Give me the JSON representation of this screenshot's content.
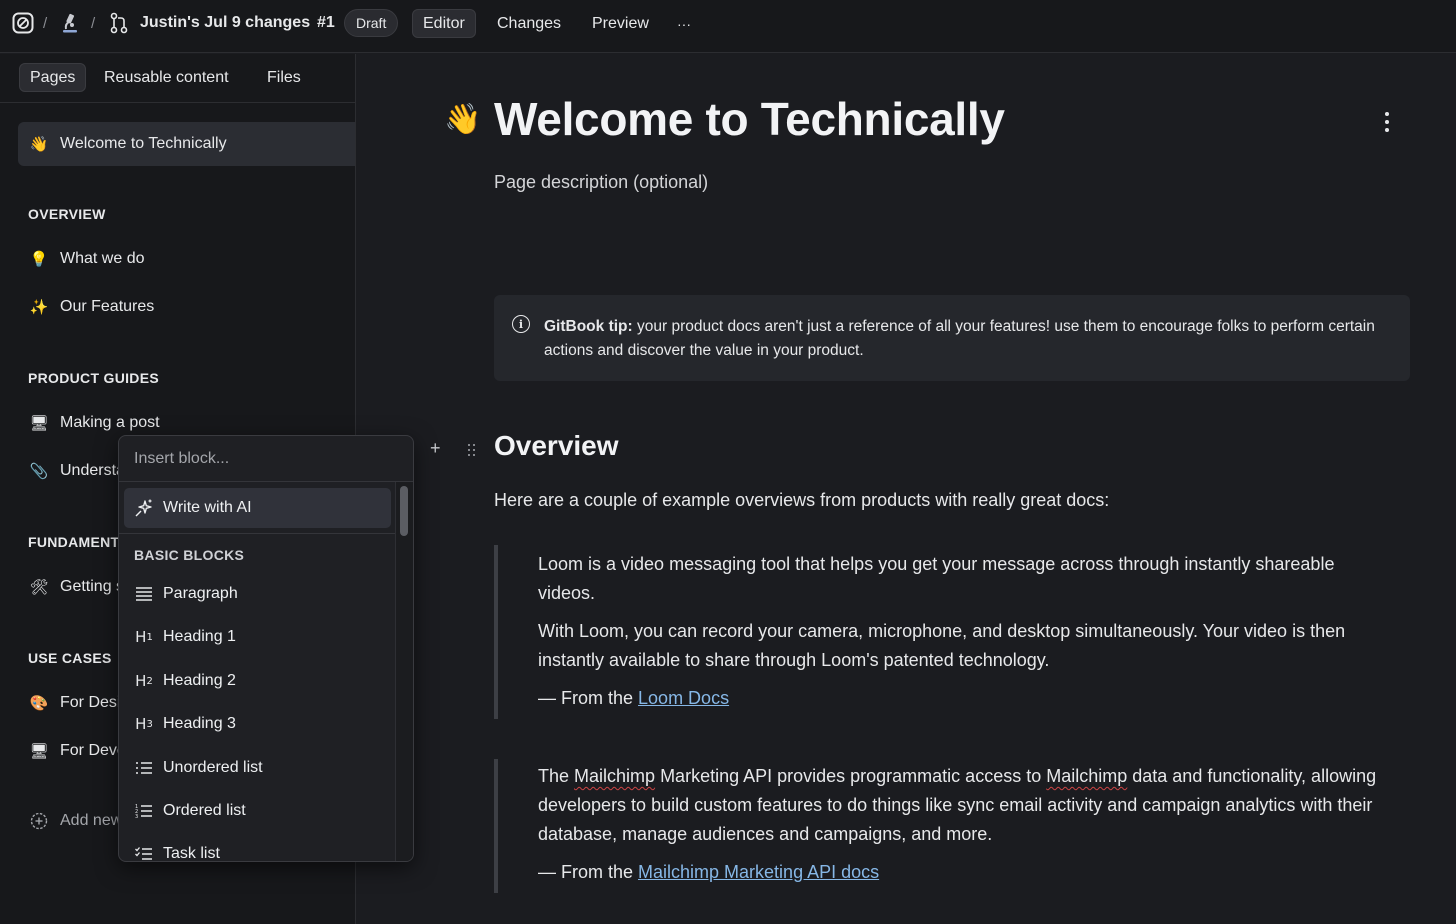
{
  "topbar": {
    "breadcrumb_sep": "/",
    "change_request_title": "Justin's Jul 9 changes",
    "change_request_number": "#1",
    "status_badge": "Draft",
    "tabs": [
      {
        "label": "Editor",
        "active": true
      },
      {
        "label": "Changes",
        "active": false
      },
      {
        "label": "Preview",
        "active": false
      }
    ],
    "more_label": "···",
    "icons": [
      "gitbook-logo-icon",
      "microscope-icon",
      "branch-icon"
    ]
  },
  "sidebar": {
    "tabs": [
      {
        "label": "Pages",
        "active": true
      },
      {
        "label": "Reusable content",
        "active": false
      },
      {
        "label": "Files",
        "active": false
      }
    ],
    "active_page": {
      "icon": "👋",
      "label": "Welcome to Technically"
    },
    "sections": [
      {
        "title": "OVERVIEW",
        "items": [
          {
            "icon": "💡",
            "label": "What we do"
          },
          {
            "icon": "✨",
            "label": "Our Features"
          }
        ]
      },
      {
        "title": "PRODUCT GUIDES",
        "items": [
          {
            "icon": "🖥",
            "label": "Making a post"
          },
          {
            "icon": "📎",
            "label": "Understanding"
          }
        ]
      },
      {
        "title": "FUNDAMENTALS",
        "items": [
          {
            "icon": "🛠",
            "label": "Getting started"
          }
        ]
      },
      {
        "title": "USE CASES",
        "items": [
          {
            "icon": "🎨",
            "label": "For Designers"
          },
          {
            "icon": "🖥",
            "label": "For Developers"
          }
        ]
      }
    ],
    "add_new_label": "Add new"
  },
  "main": {
    "title_emoji": "👋",
    "title": "Welcome to Technically",
    "description_placeholder": "Page description (optional)",
    "hint": {
      "bold": "GitBook tip:",
      "text": " your product docs aren't just a reference of all your features! use them to encourage folks to perform certain actions and discover the value in your product."
    },
    "overview_heading": "Overview",
    "overview_intro": "Here are a couple of example overviews from products with really great docs:",
    "quote1": {
      "p1": "Loom is a video messaging tool that helps you get your message across through instantly shareable videos.",
      "p2": "With Loom, you can record your camera, microphone, and desktop simultaneously. Your video is then instantly available to share through Loom's patented technology.",
      "attribution_prefix": "— From the ",
      "link": "Loom Docs"
    },
    "quote2": {
      "p1_a": "The ",
      "p1_b": "Mailchimp",
      "p1_c": " Marketing API provides programmatic access to ",
      "p1_d": "Mailchimp",
      "p1_e": " data and functionality, allowing developers to build custom features to do things like sync email activity and campaign analytics with their database, manage audiences and campaigns, and more.",
      "attribution_prefix": "— From the ",
      "link": "Mailchimp Marketing API docs"
    }
  },
  "insert_block": {
    "placeholder": "Insert block...",
    "ai_label": "Write with AI",
    "section_title": "BASIC BLOCKS",
    "items": [
      {
        "icon": "paragraph-icon",
        "label": "Paragraph"
      },
      {
        "icon": "heading-1-icon",
        "label": "Heading 1"
      },
      {
        "icon": "heading-2-icon",
        "label": "Heading 2"
      },
      {
        "icon": "heading-3-icon",
        "label": "Heading 3"
      },
      {
        "icon": "unordered-list-icon",
        "label": "Unordered list"
      },
      {
        "icon": "ordered-list-icon",
        "label": "Ordered list"
      },
      {
        "icon": "task-list-icon",
        "label": "Task list"
      }
    ]
  }
}
